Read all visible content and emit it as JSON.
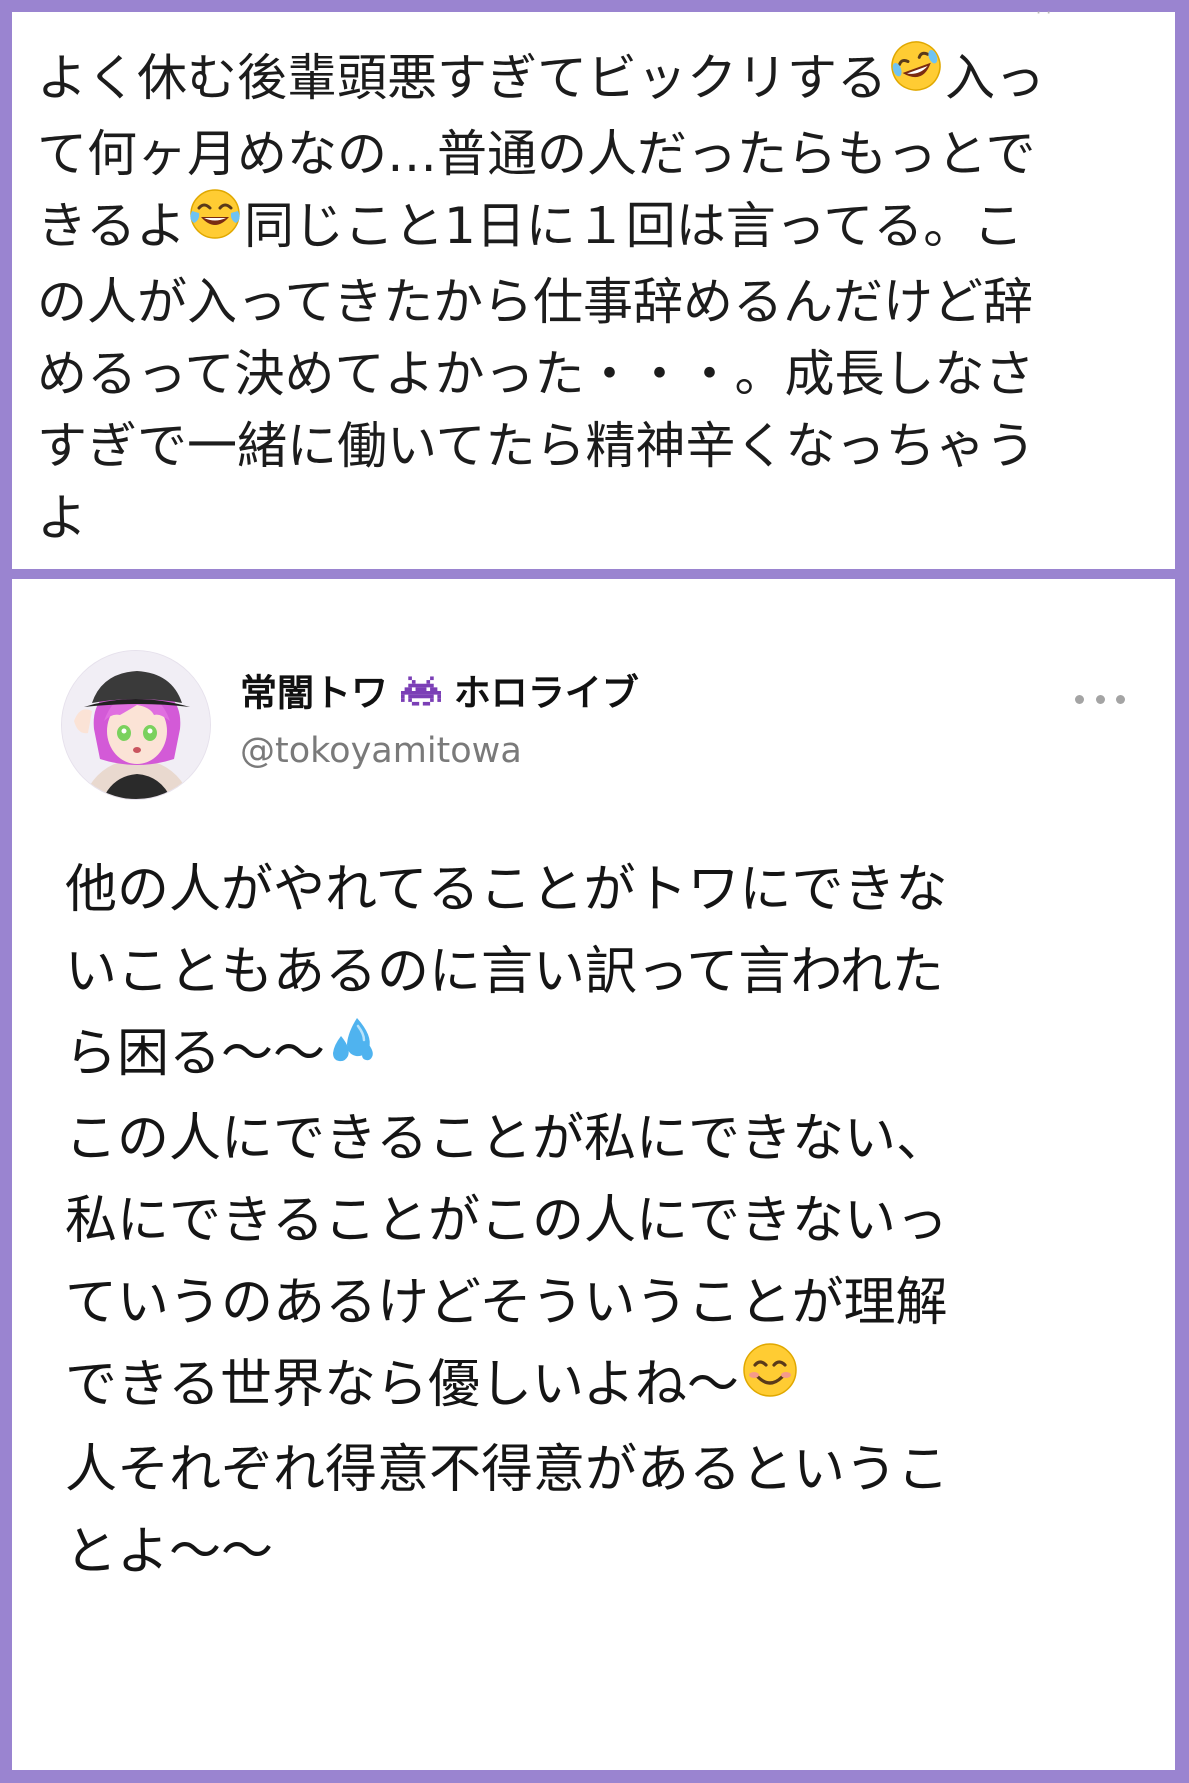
{
  "quoted_post": {
    "lines": [
      "よく休む後輩頭悪すぎてビックリする",
      "入っ",
      "て何ヶ月めなの…普通の人だったらもっとで",
      "きるよ",
      "同じこと1日に１回は言ってる。こ",
      "の人が入ってきたから仕事辞めるんだけど辞",
      "めるって決めてよかった・・・。成長しなさ",
      "すぎで一緒に働いてたら精神辛くなっちゃう",
      "よ"
    ],
    "emoji": {
      "rofl": "rolling-on-floor-laughing-emoji",
      "joy": "tears-of-joy-emoji"
    }
  },
  "tweet": {
    "display_name": "常闇トワ",
    "display_name_suffix": "ホロライブ",
    "handle": "@tokoyamitowa",
    "name_icon": "space-invader-icon",
    "more_icon": "more-horizontal-icon",
    "lines": [
      "他の人がやれてることがトワにできな",
      "いこともあるのに言い訳って言われた",
      "ら困る〜〜",
      "この人にできることが私にできない、",
      "私にできることがこの人にできないっ",
      "ていうのあるけどそういうことが理解",
      "できる世界なら優しいよね〜",
      "人それぞれ得意不得意があるというこ",
      "とよ〜〜"
    ],
    "emoji": {
      "sweat": "sweat-droplets-emoji",
      "smile": "smiling-face-emoji"
    }
  },
  "colors": {
    "frame": "#9a84d0",
    "panel": "#ffffff",
    "text": "#151515",
    "handle": "#7a7a7a",
    "invader": "#7b3fb6"
  }
}
